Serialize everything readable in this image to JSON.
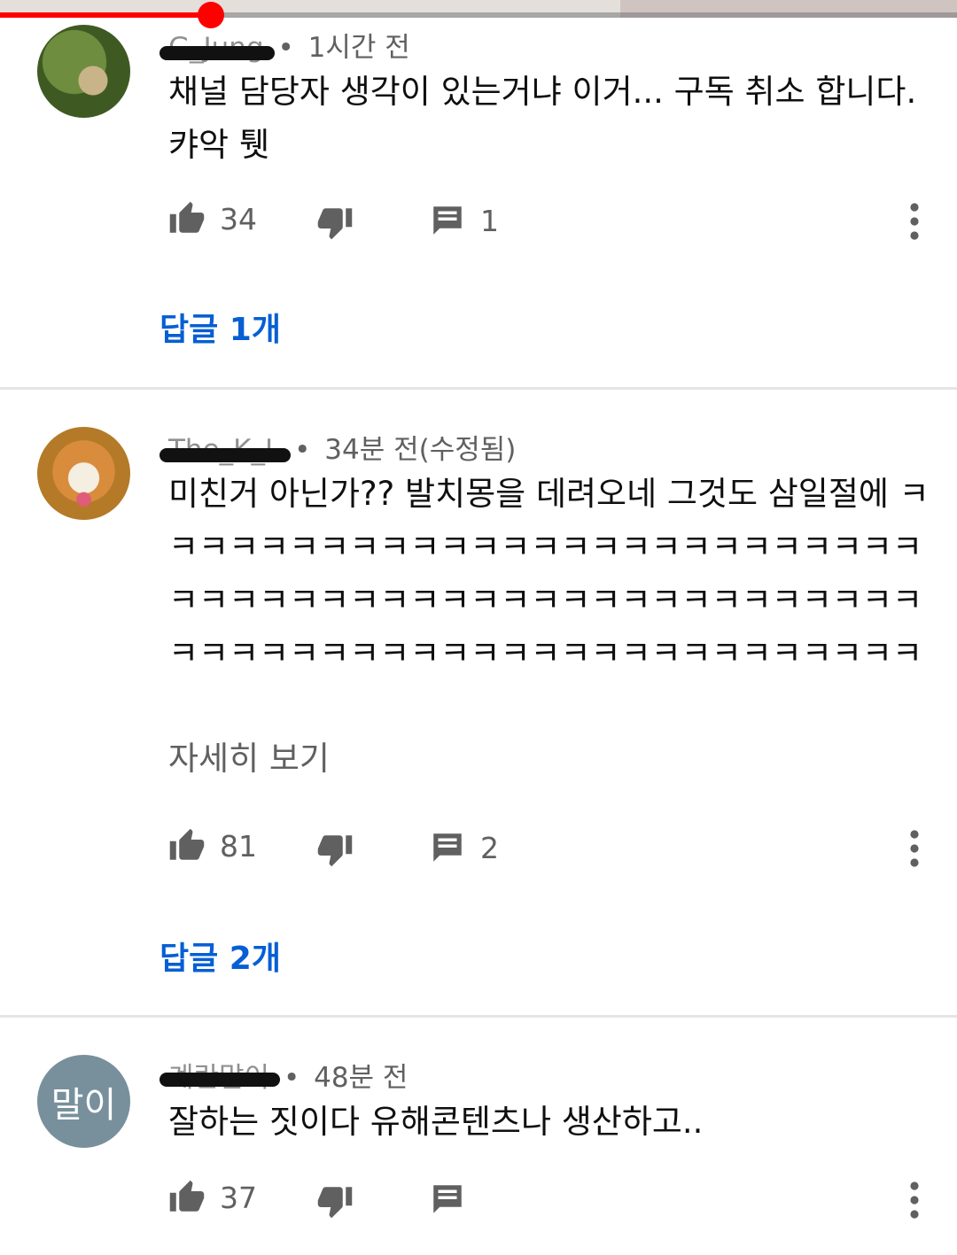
{
  "player": {
    "progress_fraction": 0.22,
    "accent_color": "#ff0000"
  },
  "colors": {
    "link": "#065fd4",
    "meta": "#606060",
    "text": "#0f0f0f"
  },
  "icons": {
    "like": "thumb-up-icon",
    "dislike": "thumb-down-icon",
    "reply": "comment-icon",
    "menu": "more-vert-icon"
  },
  "comments": [
    {
      "author": "G_Jung",
      "time": "1시간 전",
      "body": "채널 담당자 생각이 있는거냐 이거... 구독 취소 합니다. 캬악 퉷",
      "likes": "34",
      "reply_count": "1",
      "replies_link": "답글 1개"
    },
    {
      "author": "The_K_L",
      "time": "34분 전(수정됨)",
      "body": "미친거 아닌가?? 발치몽을 데려오네 그것도 삼일절에 ㅋㅋㅋㅋㅋㅋㅋㅋㅋㅋㅋㅋㅋㅋㅋㅋㅋㅋㅋㅋㅋㅋㅋㅋㅋㅋㅋㅋㅋㅋㅋㅋㅋㅋㅋㅋㅋㅋㅋㅋㅋㅋㅋㅋㅋㅋㅋㅋㅋㅋㅋㅋㅋㅋㅋㅋㅋㅋㅋㅋㅋㅋㅋㅋㅋㅋㅋㅋㅋㅋㅋㅋㅋㅋㅋㅋ",
      "read_more": "자세히 보기",
      "likes": "81",
      "reply_count": "2",
      "replies_link": "답글 2개"
    },
    {
      "author": "계란말이",
      "avatar_text": "말이",
      "time": "48분 전",
      "body": "잘하는 짓이다 유해콘텐츠나 생산하고..",
      "likes": "37"
    }
  ]
}
